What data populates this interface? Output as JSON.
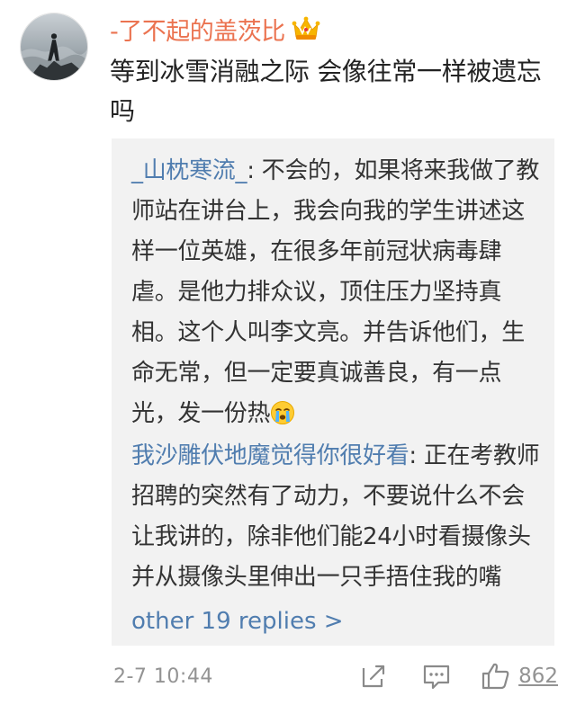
{
  "comment": {
    "username": "-了不起的盖茨比",
    "text": "等到冰雪消融之际 会像往常一样被遗忘吗",
    "timestamp": "2-7 10:44",
    "like_count": "862",
    "badge_icon": "vip-crown-icon",
    "avatar_icon": "wanderer-above-sea-of-fog-avatar"
  },
  "replies": [
    {
      "author": "_山枕寒流_",
      "separator": ": ",
      "text": "不会的，如果将来我做了教师站在讲台上，我会向我的学生讲述这样一位英雄，在很多年前冠状病毒肆虐。是他力排众议，顶住压力坚持真相。这个人叫李文亮。并告诉他们，生命无常，但一定要真诚善良，有一点光，发一份热",
      "emoji": "crying-face-emoji"
    },
    {
      "author": "我沙雕伏地魔觉得你很好看",
      "separator": ": ",
      "text": "正在考教师招聘的突然有了动力，不要说什么不会让我讲的，除非他们能24小时看摄像头并从摄像头里伸出一只手捂住我的嘴"
    }
  ],
  "more_replies_label": "other 19 replies >",
  "colors": {
    "username": "#eb7350",
    "link": "#507daf",
    "text": "#222222",
    "meta": "#939393",
    "reply_background": "#f2f2f2"
  }
}
